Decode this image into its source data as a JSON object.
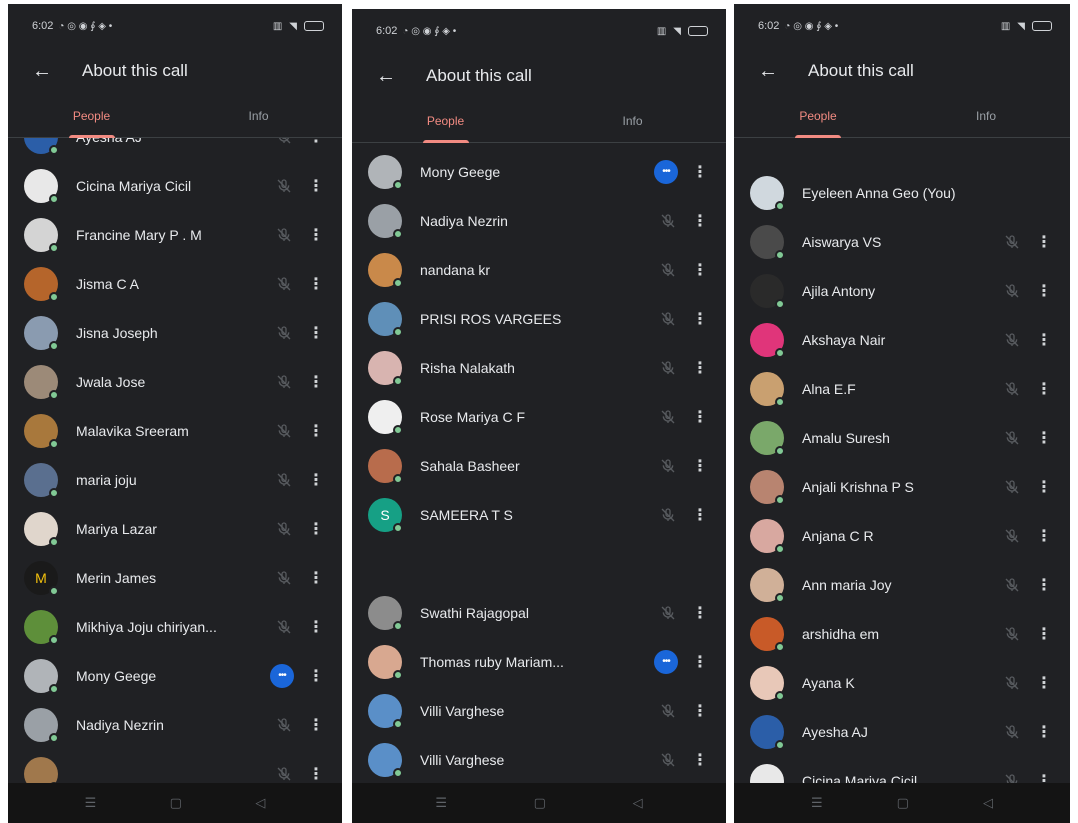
{
  "status_bar": {
    "time": "6:02"
  },
  "header": {
    "title": "About this call"
  },
  "tabs": {
    "people": "People",
    "info": "Info"
  },
  "avatar_colors": {
    "s_initial": "#16a085"
  },
  "screens": [
    {
      "people": [
        {
          "name": "Ayesha AJ",
          "avatar": "#2b5ea8",
          "status": "muted"
        },
        {
          "name": "Cicina Mariya Cicil",
          "avatar": "#e8e8e8",
          "status": "muted"
        },
        {
          "name": "Francine Mary P . M",
          "avatar": "#d4d4d4",
          "status": "muted"
        },
        {
          "name": "Jisma C A",
          "avatar": "#b5652b",
          "status": "muted"
        },
        {
          "name": "Jisna Joseph",
          "avatar": "#8a9bb0",
          "status": "muted"
        },
        {
          "name": "Jwala Jose",
          "avatar": "#9c8a78",
          "status": "muted"
        },
        {
          "name": "Malavika Sreeram",
          "avatar": "#a8783c",
          "status": "muted"
        },
        {
          "name": "maria joju",
          "avatar": "#5a6f8f",
          "status": "muted"
        },
        {
          "name": "Mariya Lazar",
          "avatar": "#e0d6cc",
          "status": "muted"
        },
        {
          "name": "Merin James",
          "avatar": "#1a1a1a",
          "initial": "M",
          "status": "muted"
        },
        {
          "name": "Mikhiya Joju chiriyan...",
          "avatar": "#5e8f3a",
          "status": "muted"
        },
        {
          "name": "Mony Geege",
          "avatar": "#b0b4b8",
          "status": "speaking"
        },
        {
          "name": "Nadiya Nezrin",
          "avatar": "#9aa0a6",
          "status": "muted"
        },
        {
          "name": "",
          "avatar": "#a0784c",
          "status": "muted"
        }
      ]
    },
    {
      "people": [
        {
          "name": "Mony Geege",
          "avatar": "#b0b4b8",
          "status": "speaking"
        },
        {
          "name": "Nadiya Nezrin",
          "avatar": "#9aa0a6",
          "status": "muted"
        },
        {
          "name": "nandana kr",
          "avatar": "#c9894a",
          "status": "muted"
        },
        {
          "name": "PRISI ROS VARGEES",
          "avatar": "#5f8fb8",
          "status": "muted"
        },
        {
          "name": "Risha Nalakath",
          "avatar": "#d8b4b0",
          "status": "muted"
        },
        {
          "name": "Rose Mariya C F",
          "avatar": "#efefef",
          "status": "muted"
        },
        {
          "name": "Sahala Basheer",
          "avatar": "#b86c4c",
          "status": "muted"
        },
        {
          "name": "SAMEERA T S",
          "avatar": "#16a085",
          "initial": "S",
          "status": "muted"
        },
        {
          "name": "",
          "avatar": "",
          "status": "empty"
        },
        {
          "name": "Swathi Rajagopal",
          "avatar": "#8c8c8c",
          "status": "muted"
        },
        {
          "name": "Thomas ruby Mariam...",
          "avatar": "#d8a890",
          "status": "speaking"
        },
        {
          "name": "Villi Varghese",
          "avatar": "#5a8fc8",
          "status": "muted"
        },
        {
          "name": "Villi Varghese",
          "avatar": "#5a8fc8",
          "status": "muted"
        }
      ]
    },
    {
      "people": [
        {
          "name": "Eyeleen Anna Geo (You)",
          "avatar": "#d0d8de",
          "status": "self"
        },
        {
          "name": "Aiswarya VS",
          "avatar": "#4a4a4a",
          "status": "muted"
        },
        {
          "name": "Ajila Antony",
          "avatar": "#2a2a2a",
          "status": "muted"
        },
        {
          "name": "Akshaya Nair",
          "avatar": "#e0357a",
          "status": "muted"
        },
        {
          "name": "Alna E.F",
          "avatar": "#c9a070",
          "status": "muted"
        },
        {
          "name": "Amalu Suresh",
          "avatar": "#7aa86a",
          "status": "muted"
        },
        {
          "name": "Anjali Krishna P S",
          "avatar": "#b88470",
          "status": "muted"
        },
        {
          "name": "Anjana C R",
          "avatar": "#d8a8a0",
          "status": "muted"
        },
        {
          "name": "Ann maria Joy",
          "avatar": "#d0b098",
          "status": "muted"
        },
        {
          "name": "arshidha em",
          "avatar": "#c85a28",
          "status": "muted"
        },
        {
          "name": "Ayana K",
          "avatar": "#e8c8b8",
          "status": "muted"
        },
        {
          "name": "Ayesha AJ",
          "avatar": "#2b5ea8",
          "status": "muted"
        },
        {
          "name": "Cicina Mariya Cicil",
          "avatar": "#e8e8e8",
          "status": "muted"
        }
      ]
    }
  ],
  "colors": {
    "background": "#202124",
    "accent": "#f28b82",
    "presence": "#81c995",
    "speaking": "#1a66d9"
  }
}
